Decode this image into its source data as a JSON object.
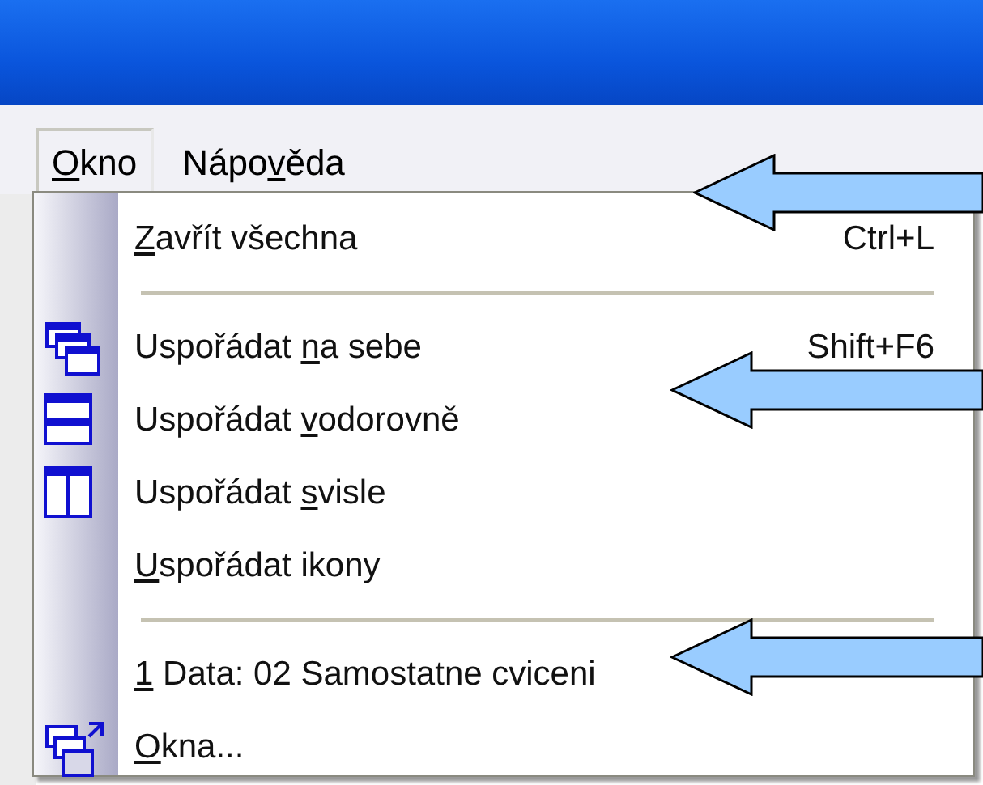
{
  "menu_bar": [
    {
      "key": "O",
      "after": "kno",
      "selected": true
    },
    {
      "before": "Nápo",
      "key": "v",
      "after": "ěda",
      "selected": false
    }
  ],
  "menu": {
    "items": [
      {
        "kind": "command",
        "key": "Z",
        "after": "avřít všechna",
        "shortcut": "Ctrl+L"
      },
      {
        "kind": "separator"
      },
      {
        "kind": "cascade",
        "before": "Uspořádat ",
        "key": "n",
        "after": "a sebe",
        "shortcut": "Shift+F6"
      },
      {
        "kind": "tile-horizontal",
        "before": "Uspořádat ",
        "key": "v",
        "after": "odorovně"
      },
      {
        "kind": "tile-vertical",
        "before": "Uspořádat ",
        "key": "s",
        "after": "visle"
      },
      {
        "kind": "command",
        "key": "U",
        "after": "spořádat ikony"
      },
      {
        "kind": "separator"
      },
      {
        "kind": "command",
        "key": "1",
        "after": " Data: 02 Samostatne cviceni"
      },
      {
        "kind": "windows",
        "key": "O",
        "after": "kna..."
      }
    ]
  }
}
